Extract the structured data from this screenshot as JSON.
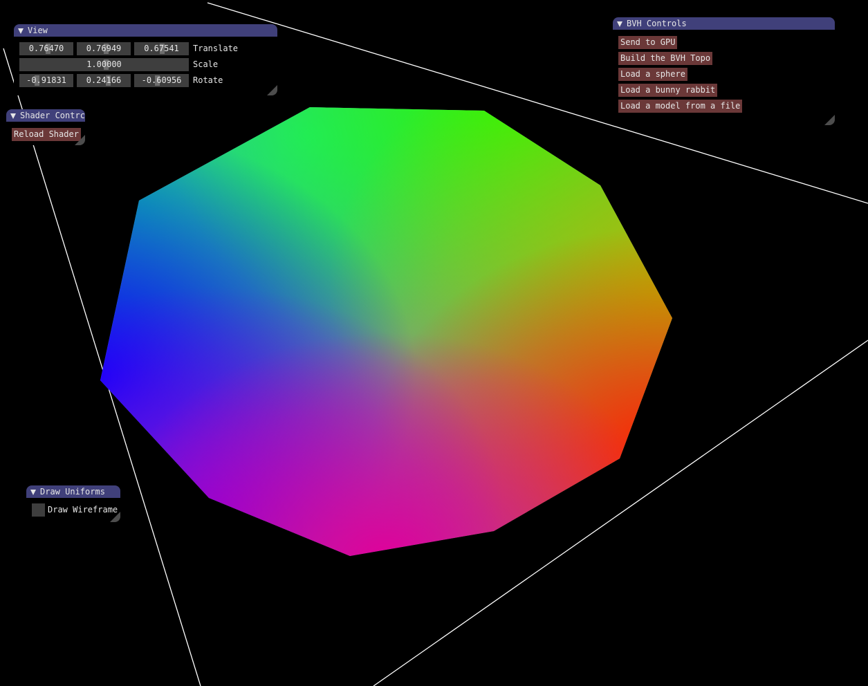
{
  "view_window": {
    "title": "View",
    "translate": {
      "values": [
        "0.76470",
        "0.76949",
        "0.67541"
      ],
      "label": "Translate"
    },
    "scale": {
      "value": "1.00000",
      "label": "Scale"
    },
    "rotate": {
      "values": [
        "-0.91831",
        "0.24166",
        "-0.60956"
      ],
      "label": "Rotate"
    }
  },
  "shader_window": {
    "title": "Shader Contrc",
    "reload_label": "Reload Shader"
  },
  "bvh_window": {
    "title": "BVH Controls",
    "buttons": [
      "Send to GPU",
      "Build the BVH Topo",
      "Load a sphere",
      "Load a bunny rabbit",
      "Load a model from a file"
    ]
  },
  "draw_window": {
    "title": "Draw Uniforms",
    "wireframe_label": "Draw Wireframe",
    "wireframe_checked": false
  },
  "colors": {
    "title_bar": "#40407a",
    "button": "#6b3838",
    "frame_bg": "#3e3e3e",
    "text": "#e6e6e6"
  }
}
